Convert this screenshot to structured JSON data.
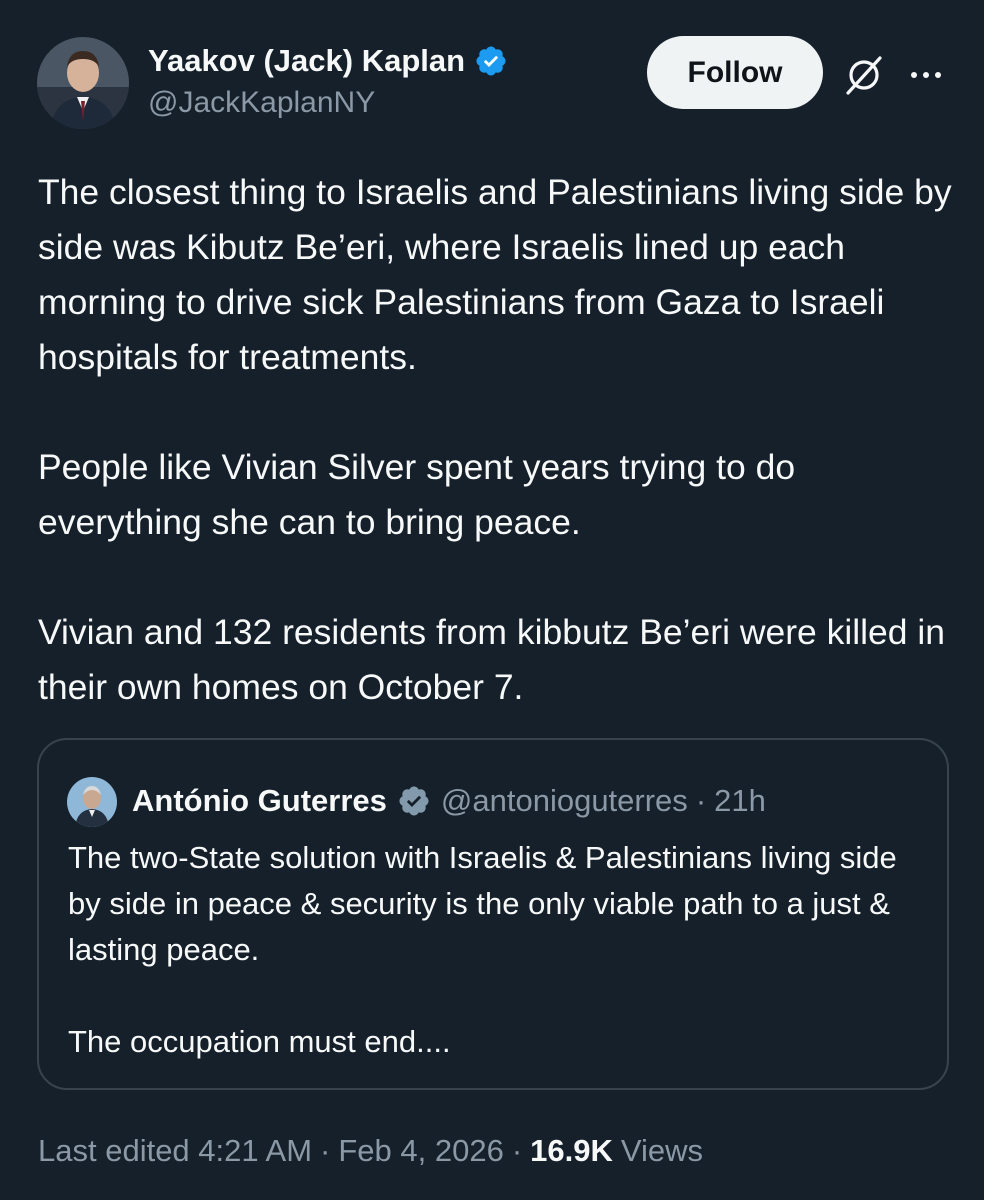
{
  "author": {
    "display_name": "Yaakov (Jack) Kaplan",
    "handle": "@JackKaplanNY",
    "avatar_icon": "user-avatar-photo",
    "verified_icon": "verified-badge-icon"
  },
  "actions": {
    "follow_label": "Follow",
    "grok_icon": "grok-icon",
    "more_icon": "more-options-icon"
  },
  "tweet": {
    "paragraphs": [
      "The closest thing to Israelis and Palestinians living side by side was Kibutz Be’eri, where Israelis lined up each morning to drive sick Palestinians from Gaza to Israeli hospitals for treatments.",
      "People like Vivian Silver spent years trying to do everything she can to bring peace.",
      "Vivian and 132 residents from kibbutz Be’eri were killed in their own homes on October 7."
    ]
  },
  "quote": {
    "display_name": "António Guterres",
    "handle": "@antonioguterres",
    "separator": "·",
    "time": "21h",
    "paragraphs": [
      "The two-State solution with Israelis & Palestinians living side by side in peace & security is the only viable path to a just & lasting peace.",
      "The occupation must end...."
    ]
  },
  "meta": {
    "edited_label": "Last edited 4:21 AM",
    "separator": "·",
    "date": "Feb 4, 2026",
    "views_count": "16.9K",
    "views_label": "Views"
  },
  "colors": {
    "background": "#15202b",
    "text_primary": "#f7f9f9",
    "text_secondary": "#8b98a5",
    "verified_blue": "#1d9bf0",
    "verified_gray": "#829aab",
    "border": "#38444d",
    "follow_bg": "#eff3f4"
  }
}
